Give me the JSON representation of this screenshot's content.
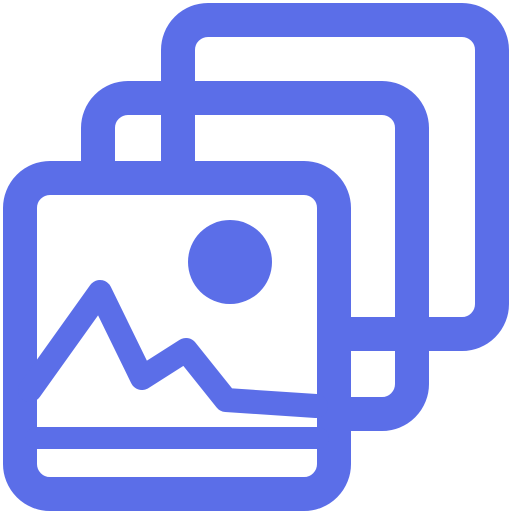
{
  "icon": {
    "semantic_name": "image-gallery-stack-icon",
    "color": "#5B6EE8",
    "background": "#FFFFFF"
  }
}
